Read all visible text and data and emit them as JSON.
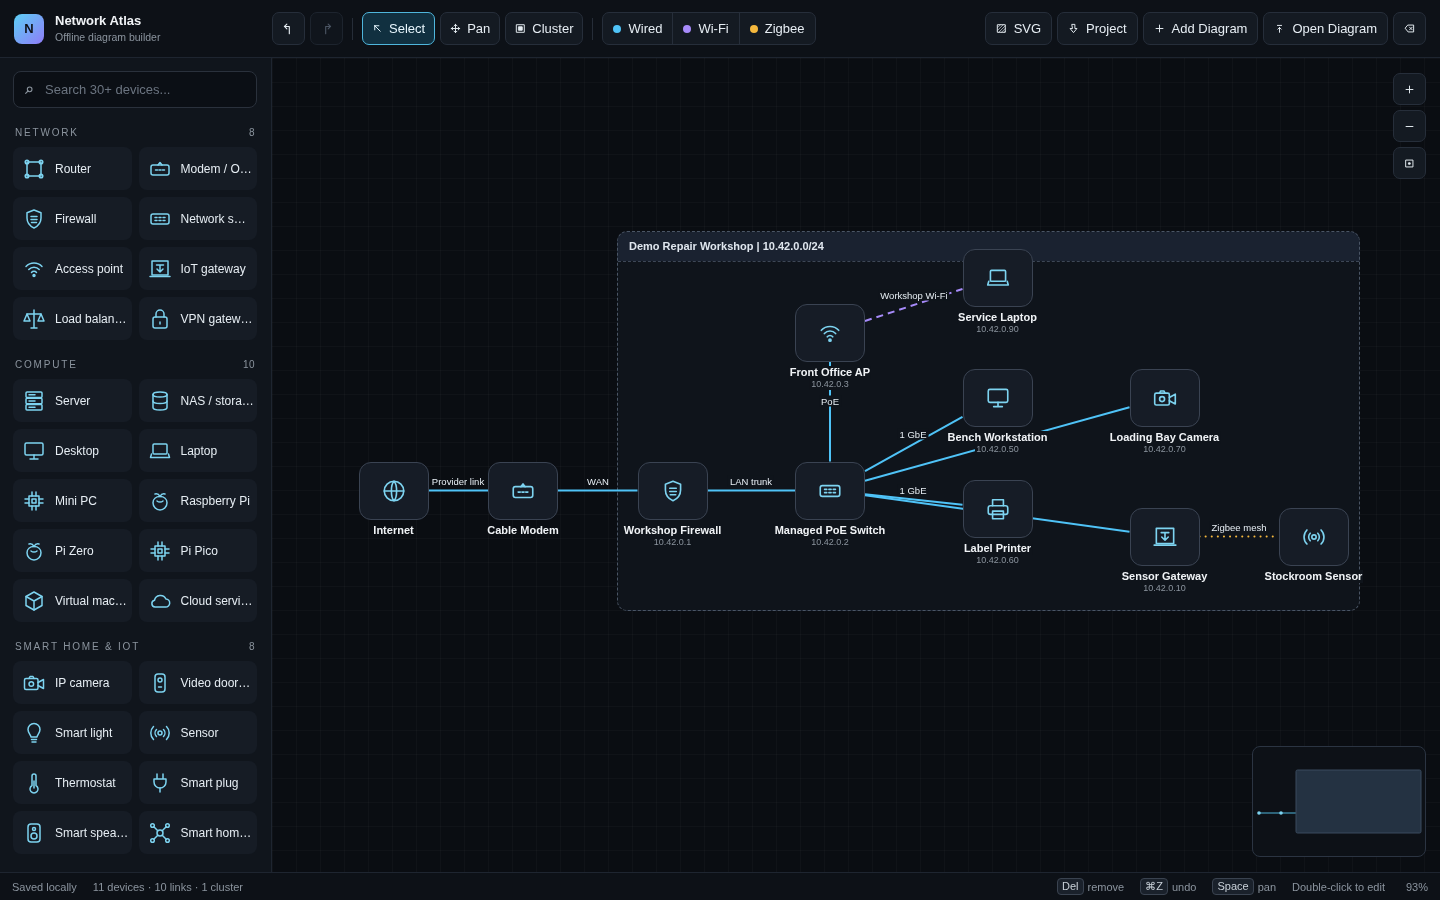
{
  "app": {
    "logo": "N",
    "title": "Network Atlas",
    "subtitle": "Offline diagram builder"
  },
  "history": [
    {
      "kind": "undo",
      "disabled": false
    },
    {
      "kind": "redo",
      "disabled": true
    }
  ],
  "tools": [
    {
      "kind": "select",
      "label": "Select",
      "selected": true
    },
    {
      "kind": "pan",
      "label": "Pan",
      "selected": false
    },
    {
      "kind": "cluster",
      "label": "Cluster",
      "selected": false
    }
  ],
  "link_types": [
    {
      "label": "Wired",
      "color": "#4fc3f7"
    },
    {
      "label": "Wi-Fi",
      "color": "#a78bfa"
    },
    {
      "label": "Zigbee",
      "color": "#f5b83d"
    }
  ],
  "actions": [
    {
      "kind": "svg",
      "label": "SVG"
    },
    {
      "kind": "download",
      "label": "Project"
    },
    {
      "kind": "add",
      "label": "Add Diagram"
    },
    {
      "kind": "open",
      "label": "Open Diagram"
    },
    {
      "kind": "clear"
    }
  ],
  "sidebar": {
    "search": {
      "placeholder": "Search 30+ devices..."
    },
    "sections": [
      {
        "title": "NETWORK",
        "count": "8",
        "items": [
          {
            "kind": "router",
            "label": "Router"
          },
          {
            "kind": "modem",
            "label": "Modem / O…"
          },
          {
            "kind": "firewall",
            "label": "Firewall"
          },
          {
            "kind": "switch",
            "label": "Network s…"
          },
          {
            "kind": "access-point",
            "label": "Access point"
          },
          {
            "kind": "iot-gateway",
            "label": "IoT gateway"
          },
          {
            "kind": "load-balancer",
            "label": "Load balan…"
          },
          {
            "kind": "vpn",
            "label": "VPN gatew…"
          }
        ]
      },
      {
        "title": "COMPUTE",
        "count": "10",
        "items": [
          {
            "kind": "server",
            "label": "Server"
          },
          {
            "kind": "nas",
            "label": "NAS / stora…"
          },
          {
            "kind": "desktop",
            "label": "Desktop"
          },
          {
            "kind": "laptop",
            "label": "Laptop"
          },
          {
            "kind": "mini-pc",
            "label": "Mini PC"
          },
          {
            "kind": "raspberry-pi",
            "label": "Raspberry Pi"
          },
          {
            "kind": "pi-zero",
            "label": "Pi Zero"
          },
          {
            "kind": "pi-pico",
            "label": "Pi Pico"
          },
          {
            "kind": "vm",
            "label": "Virtual mac…"
          },
          {
            "kind": "cloud",
            "label": "Cloud servi…"
          }
        ]
      },
      {
        "title": "SMART HOME & IOT",
        "count": "8",
        "items": [
          {
            "kind": "camera",
            "label": "IP camera"
          },
          {
            "kind": "doorbell",
            "label": "Video door…"
          },
          {
            "kind": "light",
            "label": "Smart light"
          },
          {
            "kind": "sensor",
            "label": "Sensor"
          },
          {
            "kind": "thermostat",
            "label": "Thermostat"
          },
          {
            "kind": "plug",
            "label": "Smart plug"
          },
          {
            "kind": "speaker",
            "label": "Smart spea…"
          },
          {
            "kind": "hub",
            "label": "Smart hom…"
          }
        ]
      }
    ]
  },
  "canvas": {
    "cluster": {
      "label": "Demo Repair Workshop | 10.42.0.0/24"
    },
    "nodes": [
      {
        "kind": "laptop",
        "name": "Service Laptop",
        "ip": "10.42.0.90"
      },
      {
        "kind": "access-point",
        "name": "Front Office AP",
        "ip": "10.42.0.3"
      },
      {
        "kind": "desktop",
        "name": "Bench Workstation",
        "ip": "10.42.0.50"
      },
      {
        "kind": "camera",
        "name": "Loading Bay Camera",
        "ip": "10.42.0.70"
      },
      {
        "kind": "internet",
        "name": "Internet"
      },
      {
        "kind": "modem",
        "name": "Cable Modem"
      },
      {
        "kind": "firewall",
        "name": "Workshop Firewall",
        "ip": "10.42.0.1"
      },
      {
        "kind": "switch",
        "name": "Managed PoE Switch",
        "ip": "10.42.0.2"
      },
      {
        "kind": "printer",
        "name": "Label Printer",
        "ip": "10.42.0.60"
      },
      {
        "kind": "iot-gateway",
        "name": "Sensor Gateway",
        "ip": "10.42.0.10"
      },
      {
        "kind": "sensor",
        "name": "Stockroom Sensor"
      }
    ],
    "links": [
      {
        "kind": "wifi",
        "label": "Workshop Wi-Fi"
      },
      {
        "kind": "wired",
        "label": "PoE"
      },
      {
        "kind": "wired",
        "label": "1 GbE"
      },
      {
        "kind": "wired"
      },
      {
        "kind": "wired",
        "label": "Provider link"
      },
      {
        "kind": "wired",
        "label": "WAN"
      },
      {
        "kind": "wired",
        "label": "LAN trunk"
      },
      {
        "kind": "wired",
        "label": "1 GbE"
      },
      {
        "kind": "wired"
      },
      {
        "kind": "zigbee",
        "label": "Zigbee mesh"
      }
    ]
  },
  "status_bar": {
    "save_state": "Saved locally",
    "summary": "11 devices · 10 links · 1 cluster",
    "shortcuts": [
      {
        "key": "Del",
        "action": "remove"
      },
      {
        "key": "⌘Z",
        "action": "undo"
      },
      {
        "key": "Space",
        "action": "pan"
      }
    ],
    "hint": "Double-click to edit",
    "zoom": "93%"
  }
}
